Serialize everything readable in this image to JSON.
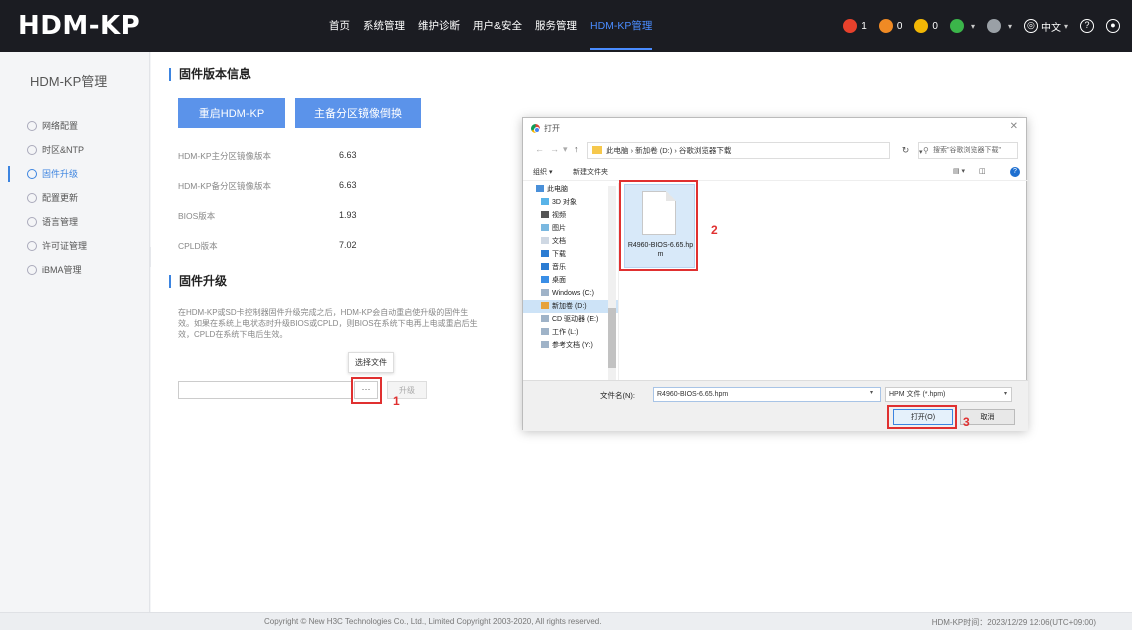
{
  "app": {
    "logo": "HDM-KP"
  },
  "nav": [
    "首页",
    "系统管理",
    "维护诊断",
    "用户&安全",
    "服务管理",
    "HDM-KP管理"
  ],
  "status": {
    "critical_count": "1",
    "major_count": "0",
    "minor_count": "0",
    "lang": "中文",
    "help": "?"
  },
  "colors": {
    "brand": "#3c84e0",
    "topbar": "#1b1c22",
    "critical": "#e8412c",
    "major": "#f08a24",
    "minor": "#f2b705",
    "annotation": "#e03030"
  },
  "sidebar": {
    "title": "HDM-KP管理",
    "items": [
      {
        "label": "网络配置",
        "icon": "globe-icon"
      },
      {
        "label": "时区&NTP",
        "icon": "clock-icon"
      },
      {
        "label": "固件升级",
        "icon": "upgrade-icon"
      },
      {
        "label": "配置更新",
        "icon": "config-icon"
      },
      {
        "label": "语言管理",
        "icon": "language-icon"
      },
      {
        "label": "许可证管理",
        "icon": "license-icon"
      },
      {
        "label": "iBMA管理",
        "icon": "ibma-icon"
      }
    ],
    "active_index": 2
  },
  "firmware_info": {
    "title": "固件版本信息",
    "restart_button": "重启HDM-KP",
    "swap_button": "主备分区镜像倒换",
    "rows": [
      {
        "label": "HDM-KP主分区镜像版本",
        "value": "6.63"
      },
      {
        "label": "HDM-KP备分区镜像版本",
        "value": "6.63"
      },
      {
        "label": "BIOS版本",
        "value": "1.93"
      },
      {
        "label": "CPLD版本",
        "value": "7.02"
      }
    ]
  },
  "firmware_upgrade": {
    "title": "固件升级",
    "description": "在HDM-KP或SD卡控制器固件升级完成之后，HDM-KP会自动重启使升级的固件生效。如果在系统上电状态时升级BIOS或CPLD，则BIOS在系统下电再上电或重启后生效，CPLD在系统下电后生效。",
    "tooltip": "选择文件",
    "browse_button": "···",
    "upgrade_button": "升级"
  },
  "dialog": {
    "title": "打开",
    "path": "此电脑 › 新加卷 (D:) › 谷歌浏览器下载",
    "search_placeholder": "搜索\"谷歌浏览器下载\"",
    "organize": "组织 ▾",
    "new_folder": "新建文件夹",
    "tree": [
      "此电脑",
      "3D 对象",
      "视频",
      "图片",
      "文档",
      "下载",
      "音乐",
      "桌面",
      "Windows (C:)",
      "新加卷 (D:)",
      "CD 驱动器 (E:)",
      "工作 (L:)",
      "参考文档 (Y:)"
    ],
    "tree_selected": 9,
    "file": "R4960-BIOS-6.65.hpm",
    "filename_label": "文件名(N):",
    "filename_value": "R4960-BIOS-6.65.hpm",
    "filetype": "HPM 文件 (*.hpm)",
    "open_button": "打开(O)",
    "cancel_button": "取消"
  },
  "annotations": [
    "1",
    "2",
    "3"
  ],
  "footer": {
    "copyright": "Copyright © New H3C Technologies Co., Ltd., Limited Copyright 2003-2020, All rights reserved.",
    "time": "HDM-KP时间：2023/12/29 12:06(UTC+09:00)"
  }
}
